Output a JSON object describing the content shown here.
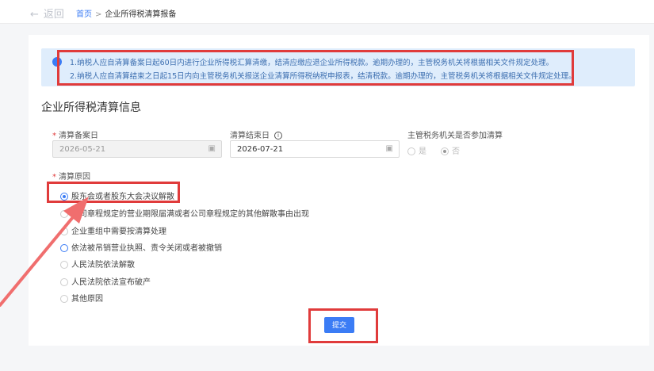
{
  "header": {
    "back_label": "返回",
    "breadcrumb_home": "首页",
    "breadcrumb_sep": ">",
    "breadcrumb_current": "企业所得税清算报备"
  },
  "notice": {
    "line1": "1.纳税人应自清算备案日起60日内进行企业所得税汇算清缴，结清应缴应退企业所得税款。逾期办理的，主管税务机关将根据相关文件规定处理。",
    "line2": "2.纳税人应自清算结束之日起15日内向主管税务机关报送企业清算所得税纳税申报表，结清税款。逾期办理的，主管税务机关将根据相关文件规定处理。"
  },
  "section_title": "企业所得税清算信息",
  "form": {
    "start_label": "清算备案日",
    "start_value": "2026-05-21",
    "end_label": "清算结束日",
    "end_value": "2026-07-21",
    "tax_label": "主管税务机关是否参加清算",
    "tax_yes": "是",
    "tax_no": "否",
    "reason_label": "清算原因",
    "reasons": [
      "股东会或者股东大会决议解散",
      "公司章程规定的营业期限届满或者公司章程规定的其他解散事由出现",
      "企业重组中需要按清算处理",
      "依法被吊销营业执照、责令关闭或者被撤销",
      "人民法院依法解散",
      "人民法院依法宣布破产",
      "其他原因"
    ],
    "submit_label": "提交"
  },
  "colors": {
    "accent": "#3b7cf5",
    "highlight": "#e03b3b",
    "notice_bg": "#dfedfc"
  }
}
